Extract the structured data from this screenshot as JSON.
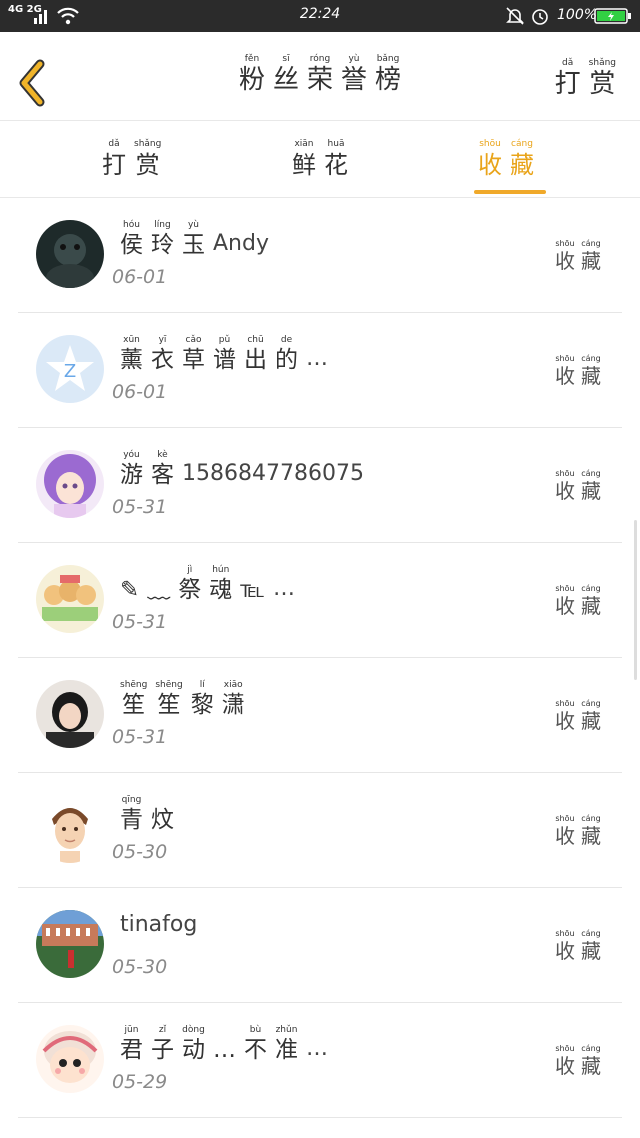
{
  "status_bar": {
    "network": "4G 2G",
    "time": "22:24",
    "battery_text": "100%",
    "battery_color": "#32d043"
  },
  "header": {
    "back_icon": "chevron-left-icon",
    "back_color": "#f0b429",
    "title": [
      {
        "py": "fěn",
        "hz": "粉"
      },
      {
        "py": "sī",
        "hz": "丝"
      },
      {
        "py": "róng",
        "hz": "荣"
      },
      {
        "py": "yù",
        "hz": "誉"
      },
      {
        "py": "bǎng",
        "hz": "榜"
      }
    ],
    "reward": [
      {
        "py": "dǎ",
        "hz": "打"
      },
      {
        "py": "shǎng",
        "hz": "赏"
      }
    ]
  },
  "tabs": [
    {
      "chars": [
        {
          "py": "dǎ",
          "hz": "打"
        },
        {
          "py": "shǎng",
          "hz": "赏"
        }
      ],
      "active": false
    },
    {
      "chars": [
        {
          "py": "xiān",
          "hz": "鲜"
        },
        {
          "py": "huā",
          "hz": "花"
        }
      ],
      "active": false
    },
    {
      "chars": [
        {
          "py": "shōu",
          "hz": "收"
        },
        {
          "py": "cáng",
          "hz": "藏"
        }
      ],
      "active": true
    }
  ],
  "accent_color": "#e9a41a",
  "action_label": [
    {
      "py": "shōu",
      "hz": "收"
    },
    {
      "py": "cáng",
      "hz": "藏"
    }
  ],
  "items": [
    {
      "name": [
        {
          "py": "hóu",
          "hz": "侯"
        },
        {
          "py": "líng",
          "hz": "玲"
        },
        {
          "py": "yù",
          "hz": "玉"
        }
      ],
      "suffix": "Andy",
      "date": "06-01"
    },
    {
      "name": [
        {
          "py": "xūn",
          "hz": "薰"
        },
        {
          "py": "yī",
          "hz": "衣"
        },
        {
          "py": "cǎo",
          "hz": "草"
        },
        {
          "py": "pǔ",
          "hz": "谱"
        },
        {
          "py": "chū",
          "hz": "出"
        },
        {
          "py": "de",
          "hz": "的"
        }
      ],
      "suffix": "…",
      "date": "06-01"
    },
    {
      "name": [
        {
          "py": "yóu",
          "hz": "游"
        },
        {
          "py": "kè",
          "hz": "客"
        }
      ],
      "suffix": "1586847786075",
      "date": "05-31"
    },
    {
      "name": [
        {
          "py": "",
          "hz": "✎"
        },
        {
          "py": "",
          "hz": "﹏"
        },
        {
          "py": "jì",
          "hz": "祭"
        },
        {
          "py": "hún",
          "hz": "魂"
        },
        {
          "py": "",
          "hz": "℡"
        }
      ],
      "suffix": "…",
      "date": "05-31"
    },
    {
      "name": [
        {
          "py": "shēng",
          "hz": "笙"
        },
        {
          "py": "shēng",
          "hz": "笙"
        },
        {
          "py": "lí",
          "hz": "黎"
        },
        {
          "py": "xiāo",
          "hz": "潇"
        }
      ],
      "suffix": "",
      "date": "05-31"
    },
    {
      "name": [
        {
          "py": "qīng",
          "hz": "青"
        },
        {
          "py": "",
          "hz": "炆"
        }
      ],
      "suffix": "",
      "date": "05-30"
    },
    {
      "name": [],
      "suffix": "tinafog",
      "date": "05-30"
    },
    {
      "name": [
        {
          "py": "jūn",
          "hz": "君"
        },
        {
          "py": "zǐ",
          "hz": "子"
        },
        {
          "py": "dòng",
          "hz": "动"
        },
        {
          "py": "",
          "hz": "…"
        },
        {
          "py": "bù",
          "hz": "不"
        },
        {
          "py": "zhǔn",
          "hz": "准"
        }
      ],
      "suffix": "…",
      "date": "05-29"
    }
  ]
}
